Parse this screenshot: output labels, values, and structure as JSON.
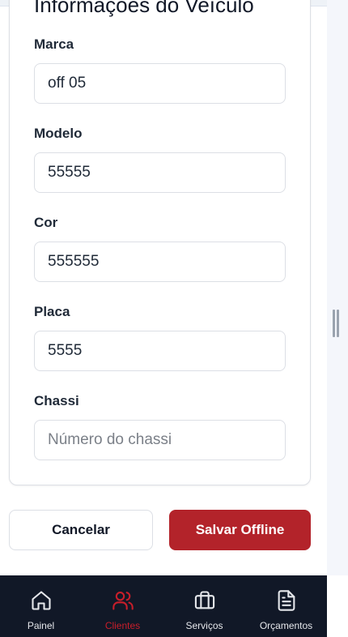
{
  "form": {
    "title": "Informações do Veículo",
    "fields": [
      {
        "label": "Marca",
        "value": "off 05",
        "placeholder": ""
      },
      {
        "label": "Modelo",
        "value": "55555",
        "placeholder": ""
      },
      {
        "label": "Cor",
        "value": "555555",
        "placeholder": ""
      },
      {
        "label": "Placa",
        "value": "5555",
        "placeholder": ""
      },
      {
        "label": "Chassi",
        "value": "",
        "placeholder": "Número do chassi"
      }
    ]
  },
  "actions": {
    "cancel_label": "Cancelar",
    "save_label": "Salvar Offline"
  },
  "bottom_nav": {
    "items": [
      {
        "label": "Painel",
        "icon": "home-icon",
        "active": false
      },
      {
        "label": "Clientes",
        "icon": "users-icon",
        "active": true
      },
      {
        "label": "Serviços",
        "icon": "briefcase-icon",
        "active": false
      },
      {
        "label": "Orçamentos",
        "icon": "document-icon",
        "active": false
      }
    ]
  },
  "colors": {
    "accent": "#b3232a",
    "nav_background": "#111827",
    "nav_active": "#c81e2a"
  }
}
